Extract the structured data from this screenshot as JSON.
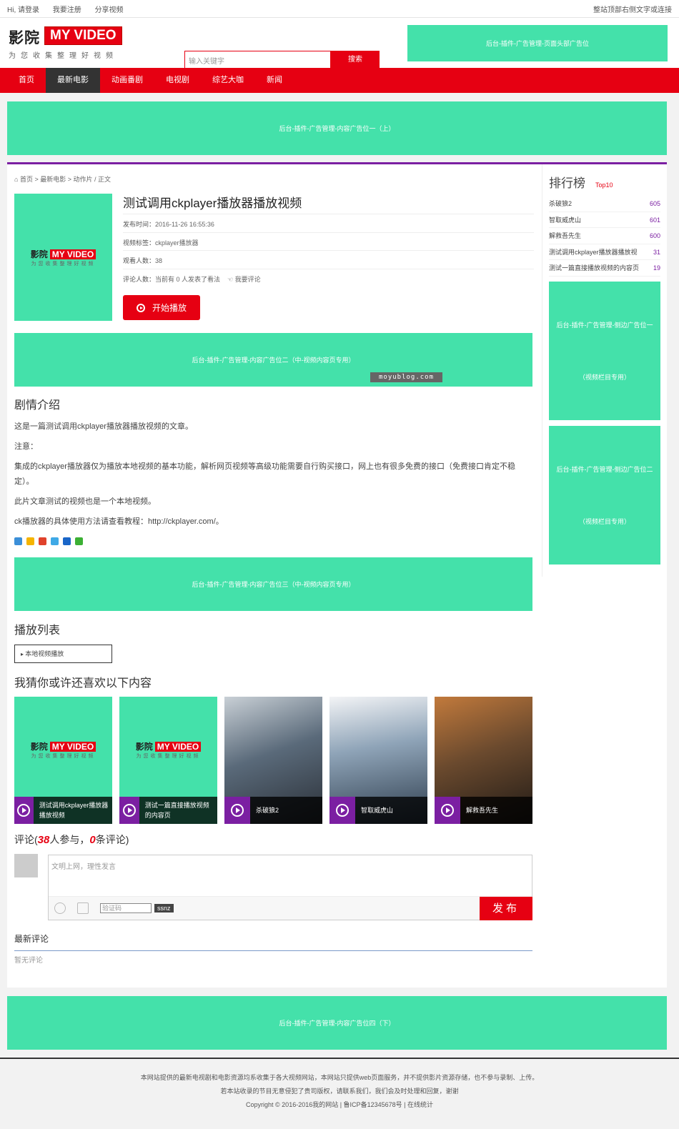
{
  "topbar": {
    "greeting": "Hi, 请登录",
    "register": "我要注册",
    "share": "分享视频",
    "right_text": "整站顶部右侧文字或连接"
  },
  "logo": {
    "cn": "影院",
    "en": "MY VIDEO",
    "slogan": "为您收集整理好视频"
  },
  "search": {
    "placeholder": "输入关键字",
    "button": "搜索"
  },
  "ads": {
    "header": "后台-插件-广告管理-页面头部广告位",
    "content_top": "后台-插件-广告管理-内容广告位一（上）",
    "content_mid2": "后台-插件-广告管理-内容广告位二（中-视频内容页专用）",
    "content_mid3": "后台-插件-广告管理-内容广告位三（中-视频内容页专用）",
    "side1": "后台-插件-广告管理-侧边广告位一",
    "side2": "后台-插件-广告管理-侧边广告位二",
    "side_sub": "（视频栏目专用）",
    "content_bottom": "后台-插件-广告管理-内容广告位四（下）"
  },
  "nav": [
    "首页",
    "最新电影",
    "动画番剧",
    "电视剧",
    "综艺大咖",
    "新闻"
  ],
  "breadcrumb": {
    "icon": "home-icon",
    "home": "首页",
    "cat": "最新电影",
    "sub": "动作片 / 正文"
  },
  "article": {
    "title": "测试调用ckplayer播放器播放视频",
    "publish_label": "发布时间：",
    "publish_time": "2016-11-26 16:55:36",
    "tag_label": "视频标签：",
    "tag": "ckplayer播放器",
    "views_label": "观看人数：",
    "views": "38",
    "comments_label": "评论人数：",
    "comments_text": "当前有 0 人发表了看法",
    "comment_link": "我要评论",
    "play_button": "开始播放"
  },
  "watermark": "moyublog.com",
  "synopsis": {
    "heading": "剧情介绍",
    "paragraphs": [
      "这是一篇测试调用ckplayer播放器播放视频的文章。",
      "注意：",
      "集成的ckplayer播放器仅为播放本地视频的基本功能，解析网页视频等高级功能需要自行购买接口，网上也有很多免费的接口（免费接口肯定不稳定）。",
      "此片文章测试的视频也是一个本地视频。",
      "ck播放器的具体使用方法请查看教程：http://ckplayer.com/。"
    ]
  },
  "playlist": {
    "heading": "播放列表",
    "item": "本地视频播放"
  },
  "recommend": {
    "heading": "我猜你或许还喜欢以下内容",
    "items": [
      {
        "title": "测试调用ckplayer播放器播放视频",
        "type": "placeholder"
      },
      {
        "title": "测试一篇直接播放视频的内容页",
        "type": "placeholder"
      },
      {
        "title": "杀破狼2",
        "type": "poster",
        "color": "#5a6a7a"
      },
      {
        "title": "智取威虎山",
        "type": "poster",
        "color": "#8fa4b8"
      },
      {
        "title": "解救吾先生",
        "type": "poster",
        "color": "#6b4a2e"
      }
    ]
  },
  "comments": {
    "label_pre": "评论(",
    "join_count": "38",
    "join_label": "人参与，",
    "count": "0",
    "count_label": "条评论)",
    "placeholder": "文明上网，理性发言",
    "captcha_placeholder": "验证码",
    "captcha": "ssnz",
    "submit": "发布",
    "latest_heading": "最新评论",
    "empty": "暂无评论"
  },
  "ranking": {
    "heading": "排行榜",
    "badge": "Top10",
    "items": [
      {
        "title": "杀破狼2",
        "count": "605"
      },
      {
        "title": "智取威虎山",
        "count": "601"
      },
      {
        "title": "解救吾先生",
        "count": "600"
      },
      {
        "title": "测试调用ckplayer播放器播放视",
        "count": "31"
      },
      {
        "title": "测试一篇直接播放视频的内容页",
        "count": "19"
      }
    ]
  },
  "footer": {
    "line1": "本网站提供的最新电视剧和电影资源均系收集于各大视频网站，本网站只提供web页面服务，并不提供影片资源存储，也不参与录制、上传。",
    "line2": "若本站收录的节目无意侵犯了贵司版权，请联系我们，我们会及时处理和回复，谢谢",
    "line3": "Copyright © 2016-2016我的网站 | 鲁ICP备12345678号 | 在线统计"
  },
  "colors": {
    "brand": "#e60012",
    "ad": "#44e1aa",
    "accent": "#7b1fa2"
  }
}
